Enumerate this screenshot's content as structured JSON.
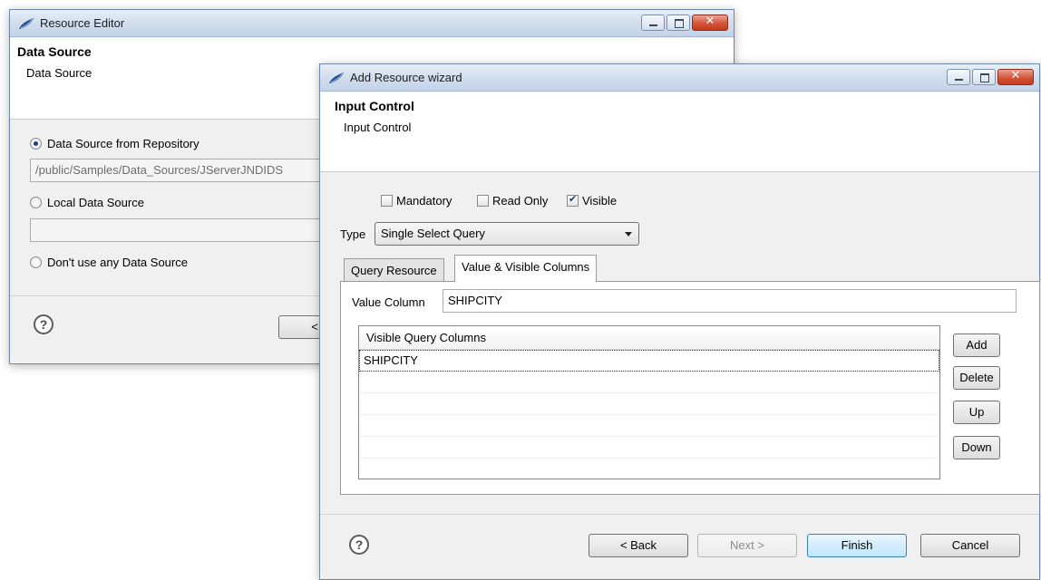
{
  "resource_editor": {
    "title": "Resource Editor",
    "header_title": "Data Source",
    "header_subtitle": "Data Source",
    "options": [
      {
        "label": "Data Source from Repository",
        "selected": true
      },
      {
        "label": "Local Data Source",
        "selected": false
      },
      {
        "label": "Don't use any Data Source",
        "selected": false
      }
    ],
    "repository_path": "/public/Samples/Data_Sources/JServerJNDIDS",
    "local_source_value": "",
    "partial_button_label": "<",
    "help_label": "?"
  },
  "wizard": {
    "title": "Add Resource wizard",
    "header_title": "Input Control",
    "header_subtitle": "Input Control",
    "checkboxes": [
      {
        "label": "Mandatory",
        "checked": false
      },
      {
        "label": "Read Only",
        "checked": false
      },
      {
        "label": "Visible",
        "checked": true
      }
    ],
    "type_label": "Type",
    "type_value": "Single Select Query",
    "tabs": [
      {
        "label": "Query Resource",
        "active": false
      },
      {
        "label": "Value & Visible Columns",
        "active": true
      }
    ],
    "value_column_label": "Value Column",
    "value_column_value": "SHIPCITY",
    "table": {
      "header": "Visible Query Columns",
      "rows": [
        "SHIPCITY"
      ]
    },
    "side_buttons": {
      "add": "Add",
      "delete": "Delete",
      "up": "Up",
      "down": "Down"
    },
    "footer": {
      "back": "< Back",
      "next": "Next >",
      "finish": "Finish",
      "cancel": "Cancel"
    },
    "help_label": "?"
  }
}
